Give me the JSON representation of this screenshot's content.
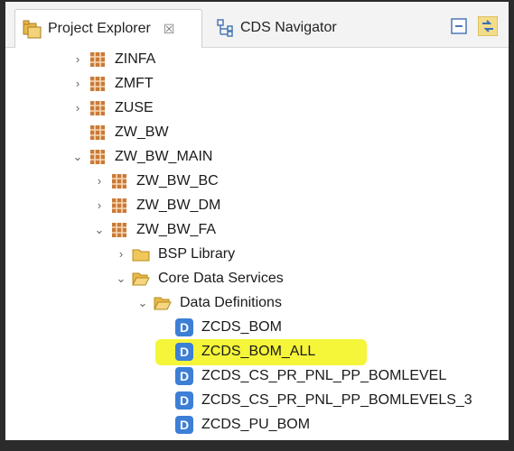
{
  "tabs": [
    {
      "label": "Project Explorer",
      "close": "☒",
      "active": true
    },
    {
      "label": "CDS Navigator",
      "active": false
    }
  ],
  "toolbar": {
    "collapse_icon": "collapse-all-icon",
    "link_icon": "link-with-editor-icon"
  },
  "tree": [
    {
      "label": "ZINFA",
      "arrow": "›",
      "icon": "package-icon"
    },
    {
      "label": "ZMFT",
      "arrow": "›",
      "icon": "package-icon"
    },
    {
      "label": "ZUSE",
      "arrow": "›",
      "icon": "package-icon"
    },
    {
      "label": "ZW_BW",
      "arrow": "",
      "icon": "package-icon"
    },
    {
      "label": "ZW_BW_MAIN",
      "arrow": "⌄",
      "icon": "package-icon"
    },
    {
      "label": "ZW_BW_BC",
      "arrow": "›",
      "icon": "package-icon"
    },
    {
      "label": "ZW_BW_DM",
      "arrow": "›",
      "icon": "package-icon"
    },
    {
      "label": "ZW_BW_FA",
      "arrow": "⌄",
      "icon": "package-icon"
    },
    {
      "label": "BSP Library",
      "arrow": "›",
      "icon": "folder-icon"
    },
    {
      "label": "Core Data Services",
      "arrow": "⌄",
      "icon": "folder-open-icon"
    },
    {
      "label": "Data Definitions",
      "arrow": "⌄",
      "icon": "folder-open-icon"
    },
    {
      "label": "ZCDS_BOM",
      "icon": "data-definition-icon",
      "icon_text": "D"
    },
    {
      "label": "ZCDS_BOM_ALL",
      "icon": "data-definition-icon",
      "icon_text": "D",
      "highlighted": true
    },
    {
      "label": "ZCDS_CS_PR_PNL_PP_BOMLEVEL",
      "icon": "data-definition-icon",
      "icon_text": "D"
    },
    {
      "label": "ZCDS_CS_PR_PNL_PP_BOMLEVELS_3",
      "icon": "data-definition-icon",
      "icon_text": "D"
    },
    {
      "label": "ZCDS_PU_BOM",
      "icon": "data-definition-icon",
      "icon_text": "D"
    }
  ],
  "colors": {
    "highlight": "#f5f53a",
    "ddl_icon": "#3d7fd6",
    "package": "#b5651d"
  }
}
